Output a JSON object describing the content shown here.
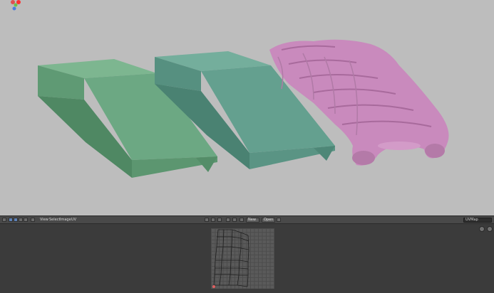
{
  "header": {
    "view_menu": "View",
    "select_menu": "Select",
    "image_menu": "Image",
    "uvs_menu": "UV",
    "image_dropdown": "New",
    "open_button": "Open",
    "field_value": "UVMap",
    "search_icon": "search-icon",
    "pin_icon": "pin-icon"
  },
  "colors": {
    "viewport_bg": "#bdbdbd",
    "cloth_green": "#6ca883",
    "cloth_teal": "#64a08f",
    "puffer_pink": "#c98abd",
    "editor_bg": "#3b3b3b",
    "header_bg": "#494949"
  },
  "gizmo": {
    "icon": "axis-gizmo-icon"
  }
}
